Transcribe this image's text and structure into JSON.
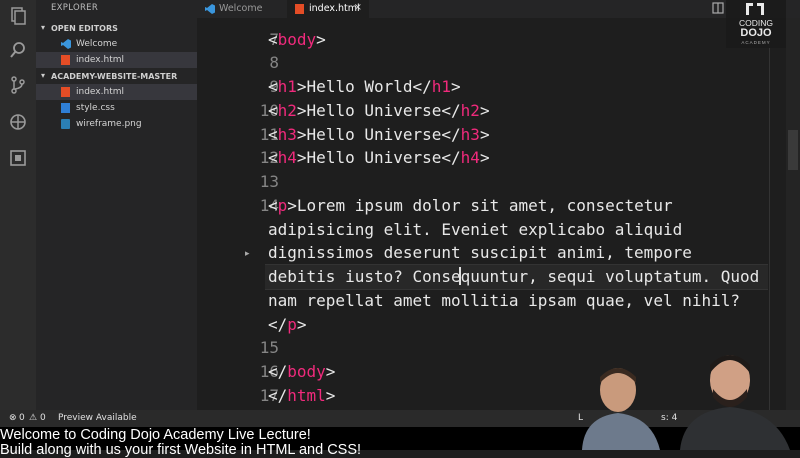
{
  "sidebar": {
    "title": "EXPLORER",
    "sections": [
      {
        "label": "OPEN EDITORS"
      },
      {
        "label": "ACADEMY-WEBSITE-MASTER"
      }
    ],
    "open_editors": [
      {
        "name": "Welcome",
        "icon": "vscode-icon"
      },
      {
        "name": "index.html",
        "icon": "html5-icon"
      }
    ],
    "files": [
      {
        "name": "index.html",
        "icon": "html5-icon"
      },
      {
        "name": "style.css",
        "icon": "css3-icon"
      },
      {
        "name": "wireframe.png",
        "icon": "image-icon"
      }
    ]
  },
  "tabs": [
    {
      "label": "Welcome"
    },
    {
      "label": "index.html",
      "close": "×"
    }
  ],
  "editor": {
    "line_numbers": [
      "7",
      "8",
      "9",
      "10",
      "11",
      "12",
      "13",
      "14",
      "15",
      "16",
      "17"
    ],
    "lines": {
      "l7_tag": "body",
      "l9_tag": "h1",
      "l9_text": "Hello World",
      "l10_tag": "h2",
      "l10_text": "Hello Universe",
      "l11_tag": "h3",
      "l11_text": "Hello Universe",
      "l12_tag": "h4",
      "l12_text": "Hello Universe",
      "l14_tag": "p",
      "l14_w1": "Lorem ipsum dolor sit amet, consectetur",
      "l14_w2": "adipisicing elit. Eveniet explicabo aliquid",
      "l14_w3": "dignissimos deserunt suscipit animi, tempore",
      "l14_w4": "debitis iusto? Consequuntur, sequi voluptatum. Quod",
      "l14_w5": "nam repellat amet mollitia ipsam quae, vel nihil?",
      "l16_tag": "body",
      "l17_tag": "html"
    }
  },
  "status": {
    "errors": "0",
    "warnings": "0",
    "preview": "Preview Available",
    "right_partial": "L",
    "spaces_partial": "s: 4"
  },
  "captions": {
    "line1": "Welcome to Coding Dojo Academy Live Lecture!",
    "line2": "Build along with us your first Website in HTML and CSS!"
  },
  "logo": {
    "line1": "CODING",
    "line2": "DOJO",
    "line3": "ACADEMY"
  },
  "colors": {
    "tag": "#f02a7c",
    "text": "#e8e8e8",
    "background": "#1e1e1e"
  }
}
